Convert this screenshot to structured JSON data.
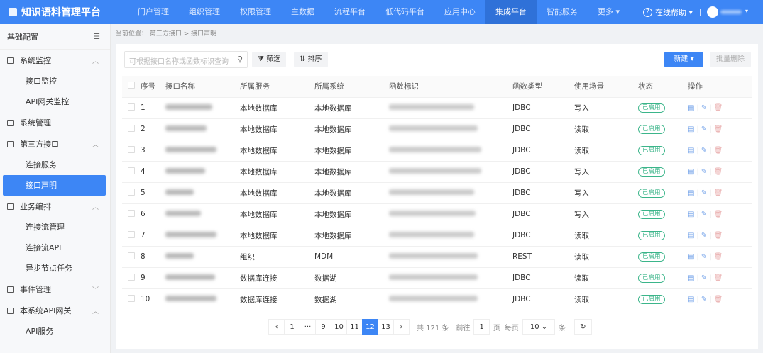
{
  "header": {
    "logo": "知识语料管理平台",
    "nav": [
      "门户管理",
      "组织管理",
      "权限管理",
      "主数据",
      "流程平台",
      "低代码平台",
      "应用中心",
      "集成平台",
      "智能服务",
      "更多"
    ],
    "active_nav": "集成平台",
    "help": "在线帮助"
  },
  "sidebar": {
    "title": "基础配置",
    "groups": [
      {
        "label": "系统监控",
        "chev": "^",
        "subs": [
          "接口监控",
          "API网关监控"
        ]
      },
      {
        "label": "系统管理",
        "chev": "",
        "subs": []
      },
      {
        "label": "第三方接口",
        "chev": "^",
        "subs": [
          "连接服务",
          "接口声明"
        ]
      },
      {
        "label": "业务编排",
        "chev": "^",
        "subs": [
          "连接流管理",
          "连接流API",
          "异步节点任务"
        ]
      },
      {
        "label": "事件管理",
        "chev": "v",
        "subs": []
      },
      {
        "label": "本系统API网关",
        "chev": "^",
        "subs": [
          "API服务"
        ]
      }
    ],
    "active": "接口声明"
  },
  "breadcrumb": {
    "prefix": "当前位置：",
    "path": "第三方接口",
    "current": "接口声明"
  },
  "toolbar": {
    "search_placeholder": "可根据接口名称或函数标识查询",
    "filter": "筛选",
    "sort": "排序",
    "new": "新建",
    "batch_delete": "批量删除"
  },
  "table": {
    "columns": [
      "序号",
      "接口名称",
      "所属服务",
      "所属系统",
      "函数标识",
      "函数类型",
      "使用场景",
      "状态",
      "操作"
    ],
    "rows": [
      [
        "1",
        "本地数据库",
        "本地数据库",
        "JDBC",
        "写入"
      ],
      [
        "2",
        "本地数据库",
        "本地数据库",
        "JDBC",
        "读取"
      ],
      [
        "3",
        "本地数据库",
        "本地数据库",
        "JDBC",
        "读取"
      ],
      [
        "4",
        "本地数据库",
        "本地数据库",
        "JDBC",
        "写入"
      ],
      [
        "5",
        "本地数据库",
        "本地数据库",
        "JDBC",
        "写入"
      ],
      [
        "6",
        "本地数据库",
        "本地数据库",
        "JDBC",
        "写入"
      ],
      [
        "7",
        "本地数据库",
        "本地数据库",
        "JDBC",
        "读取"
      ],
      [
        "8",
        "组织",
        "MDM",
        "REST",
        "读取"
      ],
      [
        "9",
        "数据库连接",
        "数据湖",
        "JDBC",
        "读取"
      ],
      [
        "10",
        "数据库连接",
        "数据湖",
        "JDBC",
        "读取"
      ]
    ],
    "status": "已启用"
  },
  "pagination": {
    "pages": [
      "1",
      "···",
      "9",
      "10",
      "11",
      "12",
      "13"
    ],
    "current": "12",
    "total": "共 121 条",
    "goto": "前往",
    "goto_value": "1",
    "page_unit": "页",
    "per_page_label": "每页",
    "per_page": "10",
    "item_unit": "条"
  }
}
